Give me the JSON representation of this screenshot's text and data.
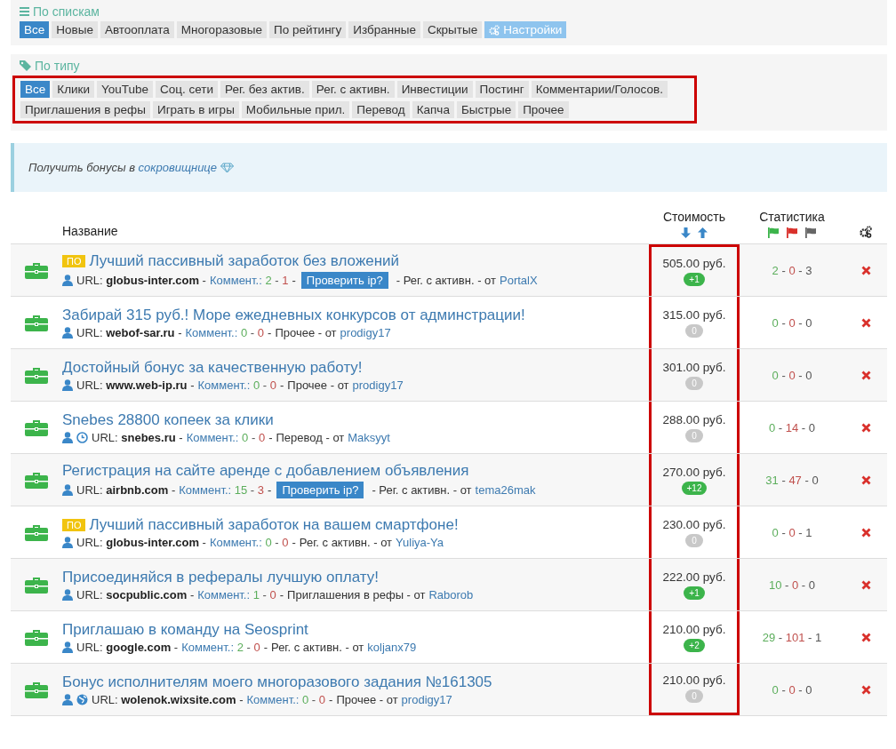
{
  "list_filter": {
    "title": "По спискам",
    "tabs": [
      {
        "label": "Все",
        "selected": true,
        "kind": "tab"
      },
      {
        "label": "Новые",
        "selected": false,
        "kind": "tab"
      },
      {
        "label": "Автооплата",
        "selected": false,
        "kind": "tab"
      },
      {
        "label": "Многоразовые",
        "selected": false,
        "kind": "tab"
      },
      {
        "label": "По рейтингу",
        "selected": false,
        "kind": "tab"
      },
      {
        "label": "Избранные",
        "selected": false,
        "kind": "tab"
      },
      {
        "label": "Скрытые",
        "selected": false,
        "kind": "tab"
      },
      {
        "label": "Настройки",
        "selected": false,
        "kind": "settings"
      }
    ]
  },
  "type_filter": {
    "title": "По типу",
    "highlighted": true,
    "tabs": [
      {
        "label": "Все",
        "selected": true
      },
      {
        "label": "Клики",
        "selected": false
      },
      {
        "label": "YouTube",
        "selected": false
      },
      {
        "label": "Соц. сети",
        "selected": false
      },
      {
        "label": "Рег. без актив.",
        "selected": false
      },
      {
        "label": "Рег. с активн.",
        "selected": false
      },
      {
        "label": "Инвестиции",
        "selected": false
      },
      {
        "label": "Постинг",
        "selected": false
      },
      {
        "label": "Комментарии/Голосов.",
        "selected": false
      },
      {
        "label": "Приглашения в рефы",
        "selected": false
      },
      {
        "label": "Играть в игры",
        "selected": false
      },
      {
        "label": "Мобильные прил.",
        "selected": false
      },
      {
        "label": "Перевод",
        "selected": false
      },
      {
        "label": "Капча",
        "selected": false
      },
      {
        "label": "Быстрые",
        "selected": false
      },
      {
        "label": "Прочее",
        "selected": false
      }
    ]
  },
  "notice": {
    "text": "Получить бонусы в",
    "link": "сокровищнице"
  },
  "table": {
    "columns": {
      "name": "Название",
      "price": "Стоимость",
      "stats": "Статистика"
    },
    "price_highlighted": true,
    "rows": [
      {
        "badge": "ПО",
        "title": "Лучший пассивный заработок без вложений",
        "icons": [
          {
            "kind": "user"
          }
        ],
        "url_label": "URL:",
        "url": "globus-inter.com",
        "url_sep": "-",
        "comment_label": "Коммент.:",
        "comments": [
          "2",
          "-",
          "1"
        ],
        "comments_sep": "-",
        "check_button": "Проверить ip?",
        "category": "- Рег. с активн. - от",
        "author": "PortalX",
        "price": "505.00 руб.",
        "bonus": "+1",
        "bonus_positive": true,
        "stats": [
          "2",
          "-",
          "0",
          "-",
          "3"
        ]
      },
      {
        "title": "Забирай 315 руб.! Море ежедневных конкурсов от админстрации!",
        "icons": [
          {
            "kind": "user"
          }
        ],
        "url_label": "URL:",
        "url": "webof-sar.ru",
        "url_sep": "-",
        "comment_label": "Коммент.:",
        "comments": [
          "0",
          "-",
          "0"
        ],
        "comments_sep": "-",
        "category": "Прочее - от",
        "author": "prodigy17",
        "price": "315.00 руб.",
        "bonus": "0",
        "bonus_positive": false,
        "stats": [
          "0",
          "-",
          "0",
          "-",
          "0"
        ]
      },
      {
        "title": "Достойный бонус за качественную работу!",
        "icons": [
          {
            "kind": "user"
          }
        ],
        "url_label": "URL:",
        "url": "www.web-ip.ru",
        "url_sep": "-",
        "comment_label": "Коммент.:",
        "comments": [
          "0",
          "-",
          "0"
        ],
        "comments_sep": "-",
        "category": "Прочее - от",
        "author": "prodigy17",
        "price": "301.00 руб.",
        "bonus": "0",
        "bonus_positive": false,
        "stats": [
          "0",
          "-",
          "0",
          "-",
          "0"
        ]
      },
      {
        "title": "Snebes 28800 копеек за клики",
        "icons": [
          {
            "kind": "user"
          },
          {
            "kind": "clock"
          }
        ],
        "url_label": "URL:",
        "url": "snebes.ru",
        "url_sep": "-",
        "comment_label": "Коммент.:",
        "comments": [
          "0",
          "-",
          "0"
        ],
        "comments_sep": "-",
        "category": "Перевод - от",
        "author": "Maksyyt",
        "price": "288.00 руб.",
        "bonus": "0",
        "bonus_positive": false,
        "stats": [
          "0",
          "-",
          "14",
          "-",
          "0"
        ]
      },
      {
        "title": "Регистрация на сайте аренде с добавлением объявления",
        "icons": [
          {
            "kind": "user"
          }
        ],
        "url_label": "URL:",
        "url": "airbnb.com",
        "url_sep": "-",
        "comment_label": "Коммент.:",
        "comments": [
          "15",
          "-",
          "3"
        ],
        "comments_sep": "-",
        "check_button": "Проверить ip?",
        "category": "- Рег. с активн. - от",
        "author": "tema26mak",
        "price": "270.00 руб.",
        "bonus": "+12",
        "bonus_positive": true,
        "stats": [
          "31",
          "-",
          "47",
          "-",
          "0"
        ]
      },
      {
        "badge": "ПО",
        "title": "Лучший пассивный заработок на вашем смартфоне!",
        "icons": [
          {
            "kind": "user"
          }
        ],
        "url_label": "URL:",
        "url": "globus-inter.com",
        "url_sep": "-",
        "comment_label": "Коммент.:",
        "comments": [
          "0",
          "-",
          "0"
        ],
        "comments_sep": "-",
        "category": "Рег. с активн. - от",
        "author": "Yuliya-Ya",
        "price": "230.00 руб.",
        "bonus": "0",
        "bonus_positive": false,
        "stats": [
          "0",
          "-",
          "0",
          "-",
          "1"
        ]
      },
      {
        "title": "Присоединяйся в рефералы лучшую оплату!",
        "icons": [
          {
            "kind": "user"
          }
        ],
        "url_label": "URL:",
        "url": "socpublic.com",
        "url_sep": "-",
        "comment_label": "Коммент.:",
        "comments": [
          "1",
          "-",
          "0"
        ],
        "comments_sep": "-",
        "category": "Приглашения в рефы - от",
        "author": "Raborob",
        "price": "222.00 руб.",
        "bonus": "+1",
        "bonus_positive": true,
        "stats": [
          "10",
          "-",
          "0",
          "-",
          "0"
        ]
      },
      {
        "title": "Приглашаю в команду на Seosprint",
        "icons": [
          {
            "kind": "user"
          }
        ],
        "url_label": "URL:",
        "url": "google.com",
        "url_sep": "-",
        "comment_label": "Коммент.:",
        "comments": [
          "2",
          "-",
          "0"
        ],
        "comments_sep": "-",
        "category": "Рег. с активн. - от",
        "author": "koljanx79",
        "price": "210.00 руб.",
        "bonus": "+2",
        "bonus_positive": true,
        "stats": [
          "29",
          "-",
          "101",
          "-",
          "1"
        ]
      },
      {
        "title": "Бонус исполнителям моего многоразового задания №161305",
        "icons": [
          {
            "kind": "user"
          },
          {
            "kind": "globe"
          }
        ],
        "url_label": "URL:",
        "url": "wolenok.wixsite.com",
        "url_sep": "-",
        "comment_label": "Коммент.:",
        "comments": [
          "0",
          "-",
          "0"
        ],
        "comments_sep": "-",
        "category": "Прочее - от",
        "author": "prodigy17",
        "price": "210.00 руб.",
        "bonus": "0",
        "bonus_positive": false,
        "stats": [
          "0",
          "-",
          "0",
          "-",
          "0"
        ]
      }
    ]
  }
}
